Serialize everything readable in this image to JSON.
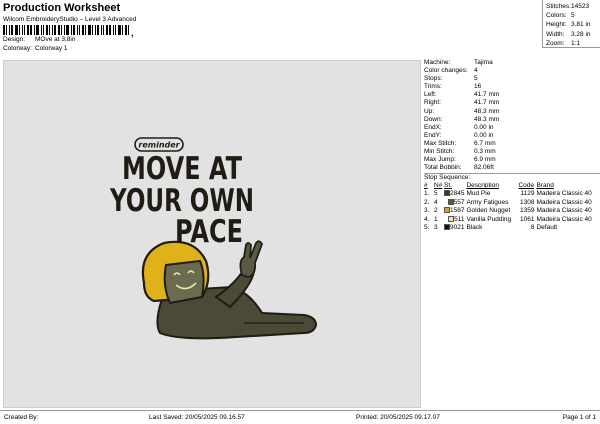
{
  "header": {
    "title": "Production Worksheet",
    "subtitle": "Wilcom EmbroideryStudio – Level 3 Advanced",
    "design_label": "Design:",
    "design_value": "MOve at 3,8in",
    "colorway_label": "Colorway:",
    "colorway_value": "Colorway 1"
  },
  "summary": {
    "stitches_label": "Stitches:",
    "stitches": "14523",
    "colors_label": "Colors:",
    "colors": "5",
    "height_label": "Height:",
    "height": "3.81 in",
    "width_label": "Width:",
    "width": "3.28 in",
    "zoom_label": "Zoom:",
    "zoom": "1:1"
  },
  "design": {
    "badge_text": "reminder",
    "line1": "MOVE AT",
    "line2": "YOUR OWN",
    "line3": "PACE",
    "colors": {
      "text": "#1f1c14",
      "helmet": "#e0b21a",
      "body": "#4a4a37",
      "visor": "#6b6b50",
      "face_outline": "#2a2a20",
      "cream": "#f4e6a0"
    }
  },
  "machine": {
    "rows": [
      {
        "label": "Machine:",
        "value": "Tajima"
      },
      {
        "label": "Color changes:",
        "value": "4"
      },
      {
        "label": "Stops:",
        "value": "5"
      },
      {
        "label": "Trims:",
        "value": "16"
      },
      {
        "label": "Left:",
        "value": "41.7 mm"
      },
      {
        "label": "Right:",
        "value": "41.7 mm"
      },
      {
        "label": "Up:",
        "value": "48.3 mm"
      },
      {
        "label": "Down:",
        "value": "48.3 mm"
      },
      {
        "label": "EndX:",
        "value": "0.00 in"
      },
      {
        "label": "EndY:",
        "value": "0.00 in"
      },
      {
        "label": "Max Stitch:",
        "value": "6.7 mm"
      },
      {
        "label": "Min Stitch:",
        "value": "0.3 mm"
      },
      {
        "label": "Max Jump:",
        "value": "6.9 mm"
      },
      {
        "label": "Total Bobbin:",
        "value": "82.06ft"
      }
    ]
  },
  "stops": {
    "title": "Stop Sequence:",
    "headers": [
      "#",
      "N#",
      "St.",
      "Description",
      "Code",
      "Brand"
    ],
    "rows": [
      {
        "num": "1.",
        "n": "5",
        "color": "#3b3324",
        "st": "2845",
        "desc": "Mud Pie",
        "code": "1129",
        "brand": "Madeira Classic 40"
      },
      {
        "num": "2.",
        "n": "4",
        "color": "#5c5a3e",
        "st": "557",
        "desc": "Army Fatigues",
        "code": "1308",
        "brand": "Madeira Classic 40"
      },
      {
        "num": "3.",
        "n": "2",
        "color": "#d9a51c",
        "st": "1587",
        "desc": "Golden Nugget",
        "code": "1359",
        "brand": "Madeira Classic 40"
      },
      {
        "num": "4.",
        "n": "1",
        "color": "#f2e3a2",
        "st": "511",
        "desc": "Vanilla Pudding",
        "code": "1061",
        "brand": "Madeira Classic 40"
      },
      {
        "num": "5.",
        "n": "3",
        "color": "#111111",
        "st": "9021",
        "desc": "Black",
        "code": "8",
        "brand": "Default"
      }
    ]
  },
  "footer": {
    "created_by": "Created By:",
    "last_saved": "Last Saved: 20/05/2025 09.16.57",
    "printed": "Printed: 20/05/2025 09.17.07",
    "page": "Page 1 of 1"
  }
}
